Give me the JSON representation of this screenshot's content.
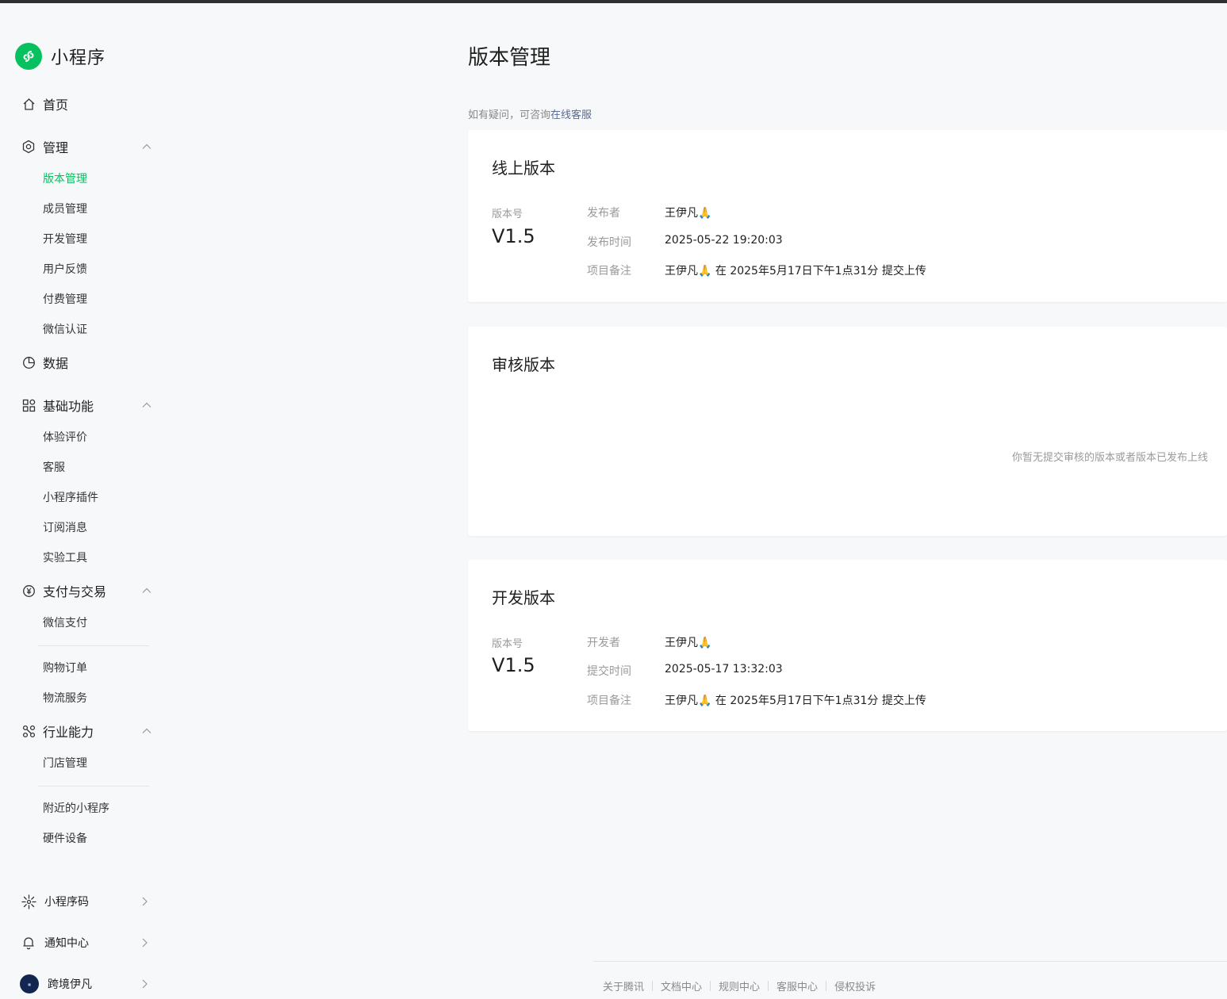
{
  "app": {
    "logo_text": "小程序"
  },
  "sidebar": {
    "home": "首页",
    "manage": {
      "label": "管理",
      "items": [
        "版本管理",
        "成员管理",
        "开发管理",
        "用户反馈",
        "付费管理",
        "微信认证"
      ]
    },
    "data": "数据",
    "basic": {
      "label": "基础功能",
      "items": [
        "体验评价",
        "客服",
        "小程序插件",
        "订阅消息",
        "实验工具"
      ]
    },
    "payment": {
      "label": "支付与交易",
      "items": [
        "微信支付",
        "购物订单",
        "物流服务"
      ]
    },
    "industry": {
      "label": "行业能力",
      "items": [
        "门店管理",
        "附近的小程序",
        "硬件设备"
      ]
    },
    "bottom": {
      "qrcode": "小程序码",
      "notify": "通知中心",
      "account": "跨境伊凡"
    }
  },
  "main": {
    "title": "版本管理",
    "help_prefix": "如有疑问，可咨询",
    "help_link": "在线客服",
    "online": {
      "title": "线上版本",
      "version_label": "版本号",
      "version": "V1.5",
      "publisher_label": "发布者",
      "publisher": "王伊凡🙏",
      "time_label": "发布时间",
      "time": "2025-05-22 19:20:03",
      "note_label": "项目备注",
      "note": "王伊凡🙏 在 2025年5月17日下午1点31分 提交上传"
    },
    "review": {
      "title": "审核版本",
      "empty": "你暂无提交审核的版本或者版本已发布上线"
    },
    "dev": {
      "title": "开发版本",
      "version_label": "版本号",
      "version": "V1.5",
      "developer_label": "开发者",
      "developer": "王伊凡🙏",
      "time_label": "提交时间",
      "time": "2025-05-17 13:32:03",
      "note_label": "项目备注",
      "note": "王伊凡🙏 在 2025年5月17日下午1点31分 提交上传"
    }
  },
  "footer": [
    "关于腾讯",
    "文档中心",
    "规则中心",
    "客服中心",
    "侵权投诉"
  ],
  "colors": {
    "accent": "#07c160",
    "link": "#576b95",
    "background": "#f6f8f9"
  }
}
